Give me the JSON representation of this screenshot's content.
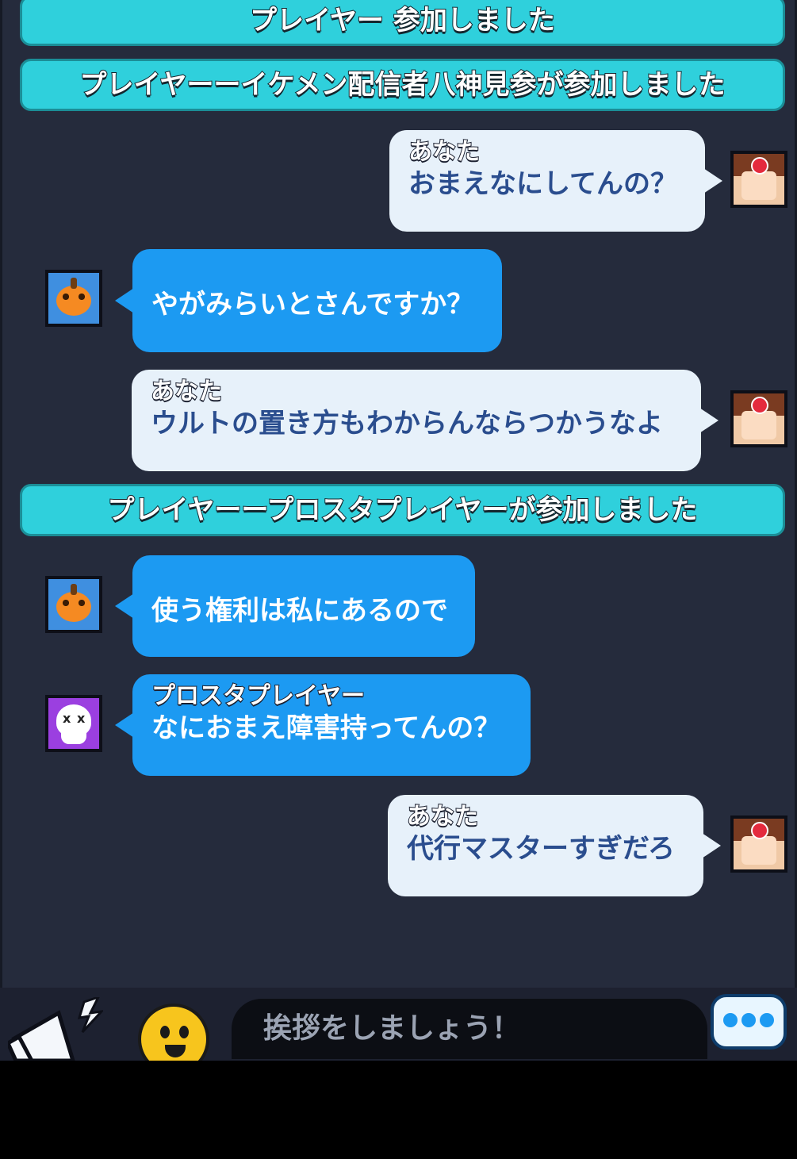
{
  "system_messages": {
    "top_partial": "プレイヤー 参加しました",
    "join1": "プレイヤーーイケメン配信者八神見参が参加しました",
    "join2": "プレイヤーープロスタプレイヤーが参加しました"
  },
  "messages": [
    {
      "sender": "あなた",
      "text": "おまえなにしてんの？",
      "side": "right"
    },
    {
      "sender": "",
      "text": "やがみらいとさんですか？",
      "side": "left"
    },
    {
      "sender": "あなた",
      "text": "ウルトの置き方もわからんならつかうなよ",
      "side": "right"
    },
    {
      "sender": "",
      "text": "使う権利は私にあるので",
      "side": "left"
    },
    {
      "sender": "プロスタプレイヤー",
      "text": "なにおまえ障害持ってんの？",
      "side": "left"
    },
    {
      "sender": "あなた",
      "text": "代行マスターすぎだろ",
      "side": "right"
    }
  ],
  "input": {
    "placeholder": "挨拶をしましょう！"
  },
  "colors": {
    "chat_bg": "#252b3c",
    "system_bar": "#2fd0dc",
    "my_bubble": "#e7f1fa",
    "their_bubble": "#1c9af2"
  },
  "icons": {
    "left_button": "megaphone-icon",
    "middle_button": "emoji-icon",
    "right_button": "chat-more-icon"
  }
}
